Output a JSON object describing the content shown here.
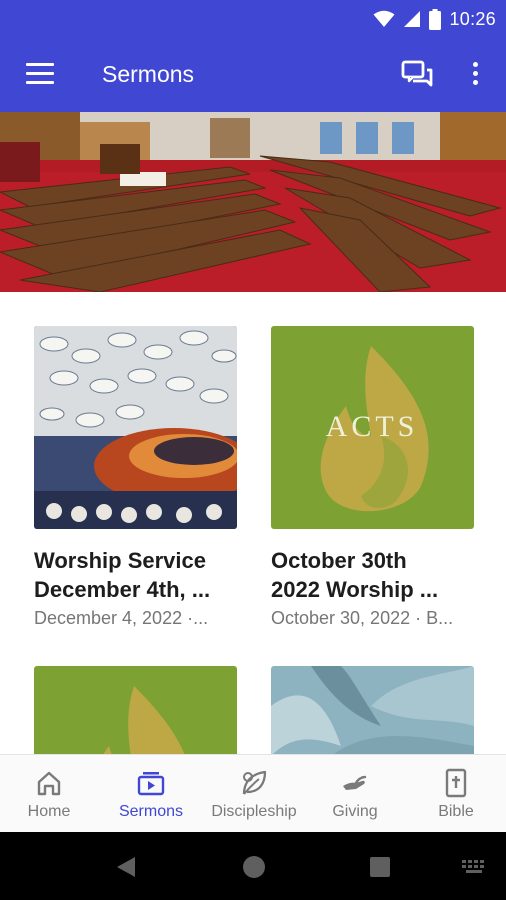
{
  "status_bar": {
    "time": "10:26"
  },
  "app_bar": {
    "title": "Sermons",
    "left_icon": "menu-icon",
    "right_icons": [
      "chat-icon",
      "more-vert-icon"
    ]
  },
  "hero": {
    "description": "church sanctuary pews"
  },
  "sermons": [
    {
      "title_line1": "Worship Service",
      "title_line2": "December 4th, ...",
      "meta": "December 4, 2022 ·..."
    },
    {
      "title_line1": "October 30th",
      "title_line2": "2022 Worship ...",
      "meta": "October 30, 2022 · B...",
      "thumb_text": "ACTS"
    },
    {
      "title_line1": "",
      "title_line2": "",
      "meta": ""
    },
    {
      "title_line1": "",
      "title_line2": "",
      "meta": ""
    }
  ],
  "bottom_nav": {
    "active": "Sermons",
    "items": [
      {
        "label": "Home",
        "icon": "home-icon"
      },
      {
        "label": "Sermons",
        "icon": "video-play-icon"
      },
      {
        "label": "Discipleship",
        "icon": "leaf-icon"
      },
      {
        "label": "Giving",
        "icon": "giving-hand-icon"
      },
      {
        "label": "Bible",
        "icon": "bible-icon"
      }
    ]
  },
  "colors": {
    "primary": "#4047d2",
    "nav_inactive": "#7a7a7a",
    "title_text": "#1d1d1d",
    "meta_text": "#767676"
  }
}
